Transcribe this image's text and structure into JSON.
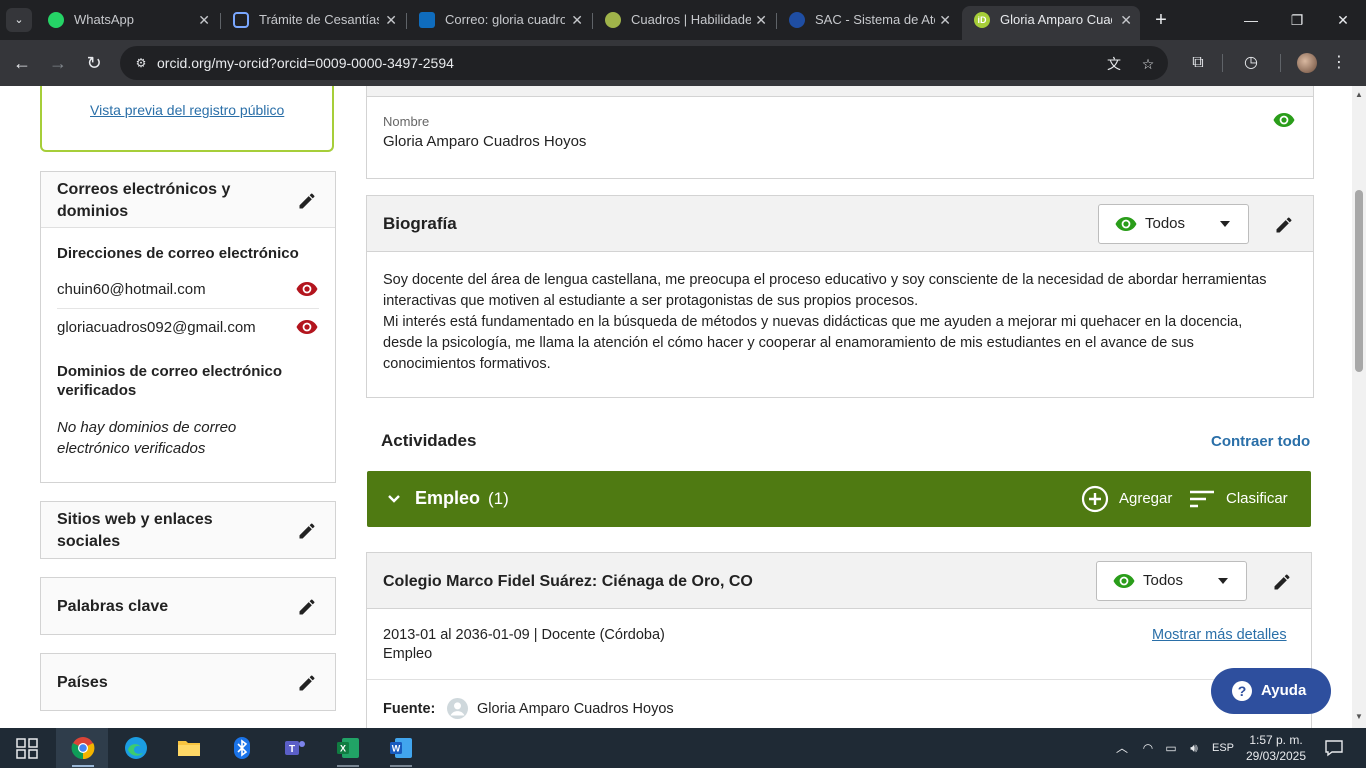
{
  "browser": {
    "tabs": [
      {
        "title": "WhatsApp"
      },
      {
        "title": "Trámite de Cesantías"
      },
      {
        "title": "Correo: gloria cuadros"
      },
      {
        "title": "Cuadros | Habilidades"
      },
      {
        "title": "SAC - Sistema de Atención"
      },
      {
        "title": "Gloria Amparo Cuadros"
      }
    ],
    "url": "orcid.org/my-orcid?orcid=0009-0000-3497-2594"
  },
  "sidebar": {
    "preview_link": "Vista previa del registro público",
    "emails_section": {
      "title": "Correos electrónicos y dominios",
      "addresses_heading": "Direcciones de correo electrónico",
      "emails": [
        "chuin60@hotmail.com",
        "gloriacuadros092@gmail.com"
      ],
      "domains_heading": "Dominios de correo electrónico verificados",
      "no_domains": "No hay dominios de correo electrónico verificados"
    },
    "websites_title": "Sitios web y enlaces sociales",
    "keywords_title": "Palabras clave",
    "countries_title": "Países"
  },
  "name_card": {
    "label": "Nombre",
    "value": "Gloria Amparo Cuadros Hoyos"
  },
  "biography": {
    "title": "Biografía",
    "visibility": "Todos",
    "lines": [
      "Soy docente del área de lengua castellana, me preocupa el proceso educativo y soy consciente de la necesidad de abordar herramientas",
      "interactivas que motiven al estudiante a ser protagonistas de sus propios procesos.",
      "Mi interés está fundamentado en la búsqueda de métodos y nuevas didácticas que me ayuden a mejorar mi quehacer en la docencia,",
      "desde la psicología, me llama la atención el cómo hacer y cooperar al enamoramiento de mis estudiantes en el avance de sus",
      "conocimientos formativos."
    ]
  },
  "activities": {
    "title": "Actividades",
    "collapse_all": "Contraer todo"
  },
  "employment": {
    "title": "Empleo",
    "count": "(1)",
    "add_label": "Agregar",
    "sort_label": "Clasificar"
  },
  "employment_item": {
    "org": "Colegio Marco Fidel Suárez: Ciénaga de Oro, CO",
    "visibility": "Todos",
    "dates_role": "2013-01 al 2036-01-09 | Docente (Córdoba)",
    "type": "Empleo",
    "more_details": "Mostrar más detalles",
    "source_label": "Fuente:",
    "source_value": "Gloria Amparo Cuadros Hoyos"
  },
  "help": {
    "label": "Ayuda"
  },
  "taskbar": {
    "lang": "ESP",
    "time": "1:57 p. m.",
    "date": "29/03/2025"
  },
  "colors": {
    "orcid_green": "#4f7a12",
    "eye_green": "#2a9d1a",
    "eye_red": "#b3151e",
    "link_blue": "#2a6fa8",
    "help_blue": "#2e4f9e"
  }
}
